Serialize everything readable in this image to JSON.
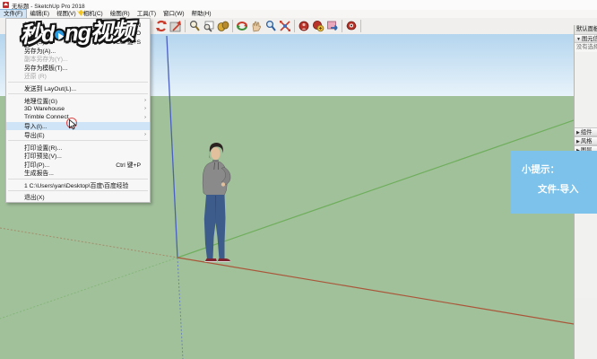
{
  "window": {
    "title": "无标题 - SketchUp Pro 2018"
  },
  "menubar": {
    "items": [
      {
        "label": "文件(F)",
        "active": true
      },
      {
        "label": "编辑(E)",
        "active": false
      },
      {
        "label": "视图(V)",
        "active": false
      },
      {
        "label": "相机(C)",
        "active": false
      },
      {
        "label": "绘图(R)",
        "active": false
      },
      {
        "label": "工具(T)",
        "active": false
      },
      {
        "label": "窗口(W)",
        "active": false
      },
      {
        "label": "帮助(H)",
        "active": false
      }
    ]
  },
  "toolbar": {
    "icons": [
      "refresh-icon",
      "swap-view-icon",
      "zoom-icon",
      "zoom-previous-icon",
      "shaded-style-icon",
      "orbit-icon",
      "pan-icon",
      "zoom-tool-icon",
      "zoom-extents-icon",
      "position-camera-icon",
      "walk-icon",
      "image-export-icon",
      "look-around-icon"
    ]
  },
  "file_menu": {
    "items": [
      {
        "label": "新建(N)",
        "accel": "Ctrl 键+N"
      },
      {
        "label": "打开(O)...",
        "accel": "Ctrl 键+O"
      },
      {
        "label": "保存(S)",
        "accel": "Ctrl 键+S"
      },
      {
        "label": "另存为(A)..."
      },
      {
        "label": "副本另存为(Y)...",
        "disabled": true
      },
      {
        "label": "另存为模板(T)..."
      },
      {
        "label": "还原 (R)",
        "disabled": true
      },
      {
        "type": "separator"
      },
      {
        "label": "发送到 LayOut(L)..."
      },
      {
        "type": "separator"
      },
      {
        "label": "地理位置(G)",
        "arrow": true
      },
      {
        "label": "3D Warehouse",
        "arrow": true
      },
      {
        "label": "Trimble Connect",
        "arrow": true
      },
      {
        "label": "导入(I)...",
        "highlighted": true
      },
      {
        "label": "导出(E)",
        "arrow": true
      },
      {
        "type": "separator"
      },
      {
        "label": "打印设置(R)..."
      },
      {
        "label": "打印预览(V)..."
      },
      {
        "label": "打印(P)...",
        "accel": "Ctrl 键+P"
      },
      {
        "label": "生成报告..."
      },
      {
        "type": "separator"
      },
      {
        "label": "1 C:\\Users\\yan\\Desktop\\百度\\百度经验"
      },
      {
        "type": "separator"
      },
      {
        "label": "退出(X)"
      }
    ]
  },
  "right_panel": {
    "header": "默认面板",
    "entity_info": "图元信息",
    "no_selection": "没有选择任何内容",
    "sections": [
      "组件",
      "风格",
      "图层"
    ]
  },
  "tooltip": {
    "line1": "小提示：",
    "line2": "文件-导入"
  },
  "watermark": {
    "pre": "秒d",
    "post": "ng",
    "suffix": "视频"
  },
  "colors": {
    "sky_top": "#b4d5ee",
    "sky_bottom": "#e8f3fb",
    "ground": "#a1c19b",
    "axis_red": "#aa5639",
    "axis_green": "#6fae5c",
    "axis_blue": "#4a5fc0",
    "tip_blue": "#7cc2ea",
    "menu_highlight": "#cfe4f6"
  }
}
